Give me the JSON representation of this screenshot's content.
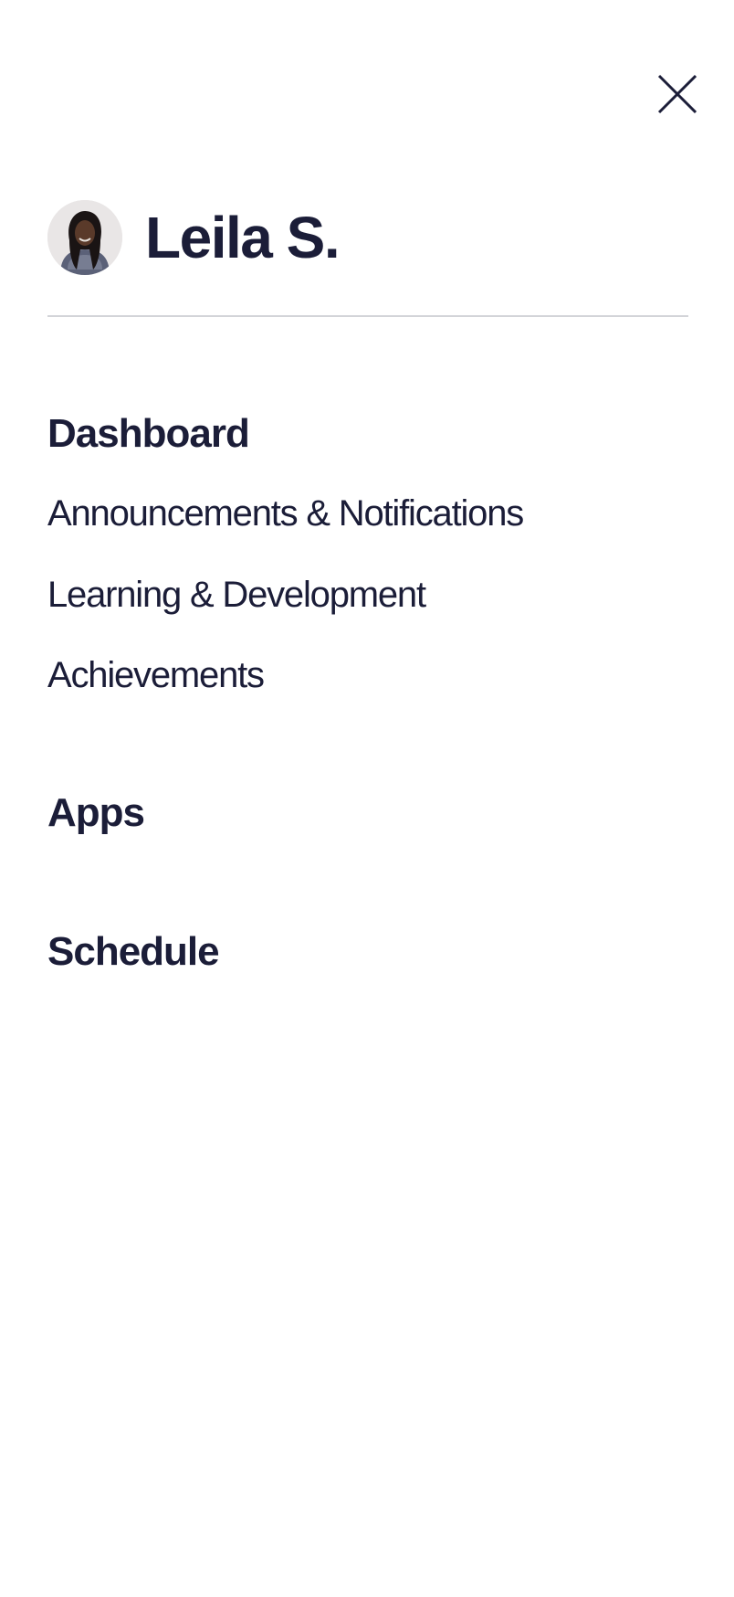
{
  "menu": {
    "close_icon": "close-icon"
  },
  "profile": {
    "name": "Leila S.",
    "avatar_icon": "user-avatar-photo"
  },
  "nav": {
    "dashboard": {
      "label": "Dashboard",
      "items": [
        "Announcements & Notifications",
        "Learning & Development",
        "Achievements"
      ]
    },
    "apps": "Apps",
    "schedule": "Schedule"
  },
  "colors": {
    "text": "#1b1d38",
    "divider": "#d3d4d8",
    "background": "#ffffff"
  }
}
